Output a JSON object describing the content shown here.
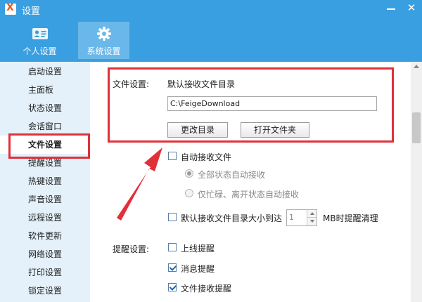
{
  "window": {
    "title": "设置",
    "logo_letter": "X",
    "minimize_icon": "minimize-icon",
    "close_symbol": "✕"
  },
  "top_tabs": [
    {
      "label": "个人设置",
      "icon": "contact-card-icon",
      "active": false
    },
    {
      "label": "系统设置",
      "icon": "gear-icon",
      "active": true
    }
  ],
  "sidebar": {
    "items": [
      {
        "label": "启动设置"
      },
      {
        "label": "主面板"
      },
      {
        "label": "状态设置"
      },
      {
        "label": "会话窗口"
      },
      {
        "label": "文件设置",
        "active": true
      },
      {
        "label": "提醒设置"
      },
      {
        "label": "热键设置"
      },
      {
        "label": "声音设置"
      },
      {
        "label": "远程设置"
      },
      {
        "label": "软件更新"
      },
      {
        "label": "网络设置"
      },
      {
        "label": "打印设置"
      },
      {
        "label": "锁定设置"
      }
    ]
  },
  "file_settings": {
    "section_label": "文件设置:",
    "default_dir_label": "默认接收文件目录",
    "default_dir_value": "C:\\FeigeDownload",
    "change_dir_button": "更改目录",
    "open_folder_button": "打开文件夹",
    "auto_receive": {
      "label": "自动接收文件",
      "checked": false
    },
    "auto_receive_all": {
      "label": "全部状态自动接收",
      "selected": true,
      "disabled": true
    },
    "auto_receive_busy": {
      "label": "仅忙碌、离开状态自动接收",
      "selected": false,
      "disabled": true
    },
    "size_limit": {
      "label": "默认接收文件目录大小到达",
      "checked": false,
      "value": "1",
      "suffix": "MB时提醒清理"
    }
  },
  "reminder_settings": {
    "section_label": "提醒设置:",
    "online": {
      "label": "上线提醒",
      "checked": false
    },
    "message": {
      "label": "消息提醒",
      "checked": true
    },
    "file_receive": {
      "label": "文件接收提醒",
      "checked": true
    }
  },
  "colors": {
    "header_blue": "#3a9fe0",
    "active_tab": "#6ab8ea",
    "sidebar_bg": "#e4f1fa",
    "annotation_red": "#e0303a"
  }
}
